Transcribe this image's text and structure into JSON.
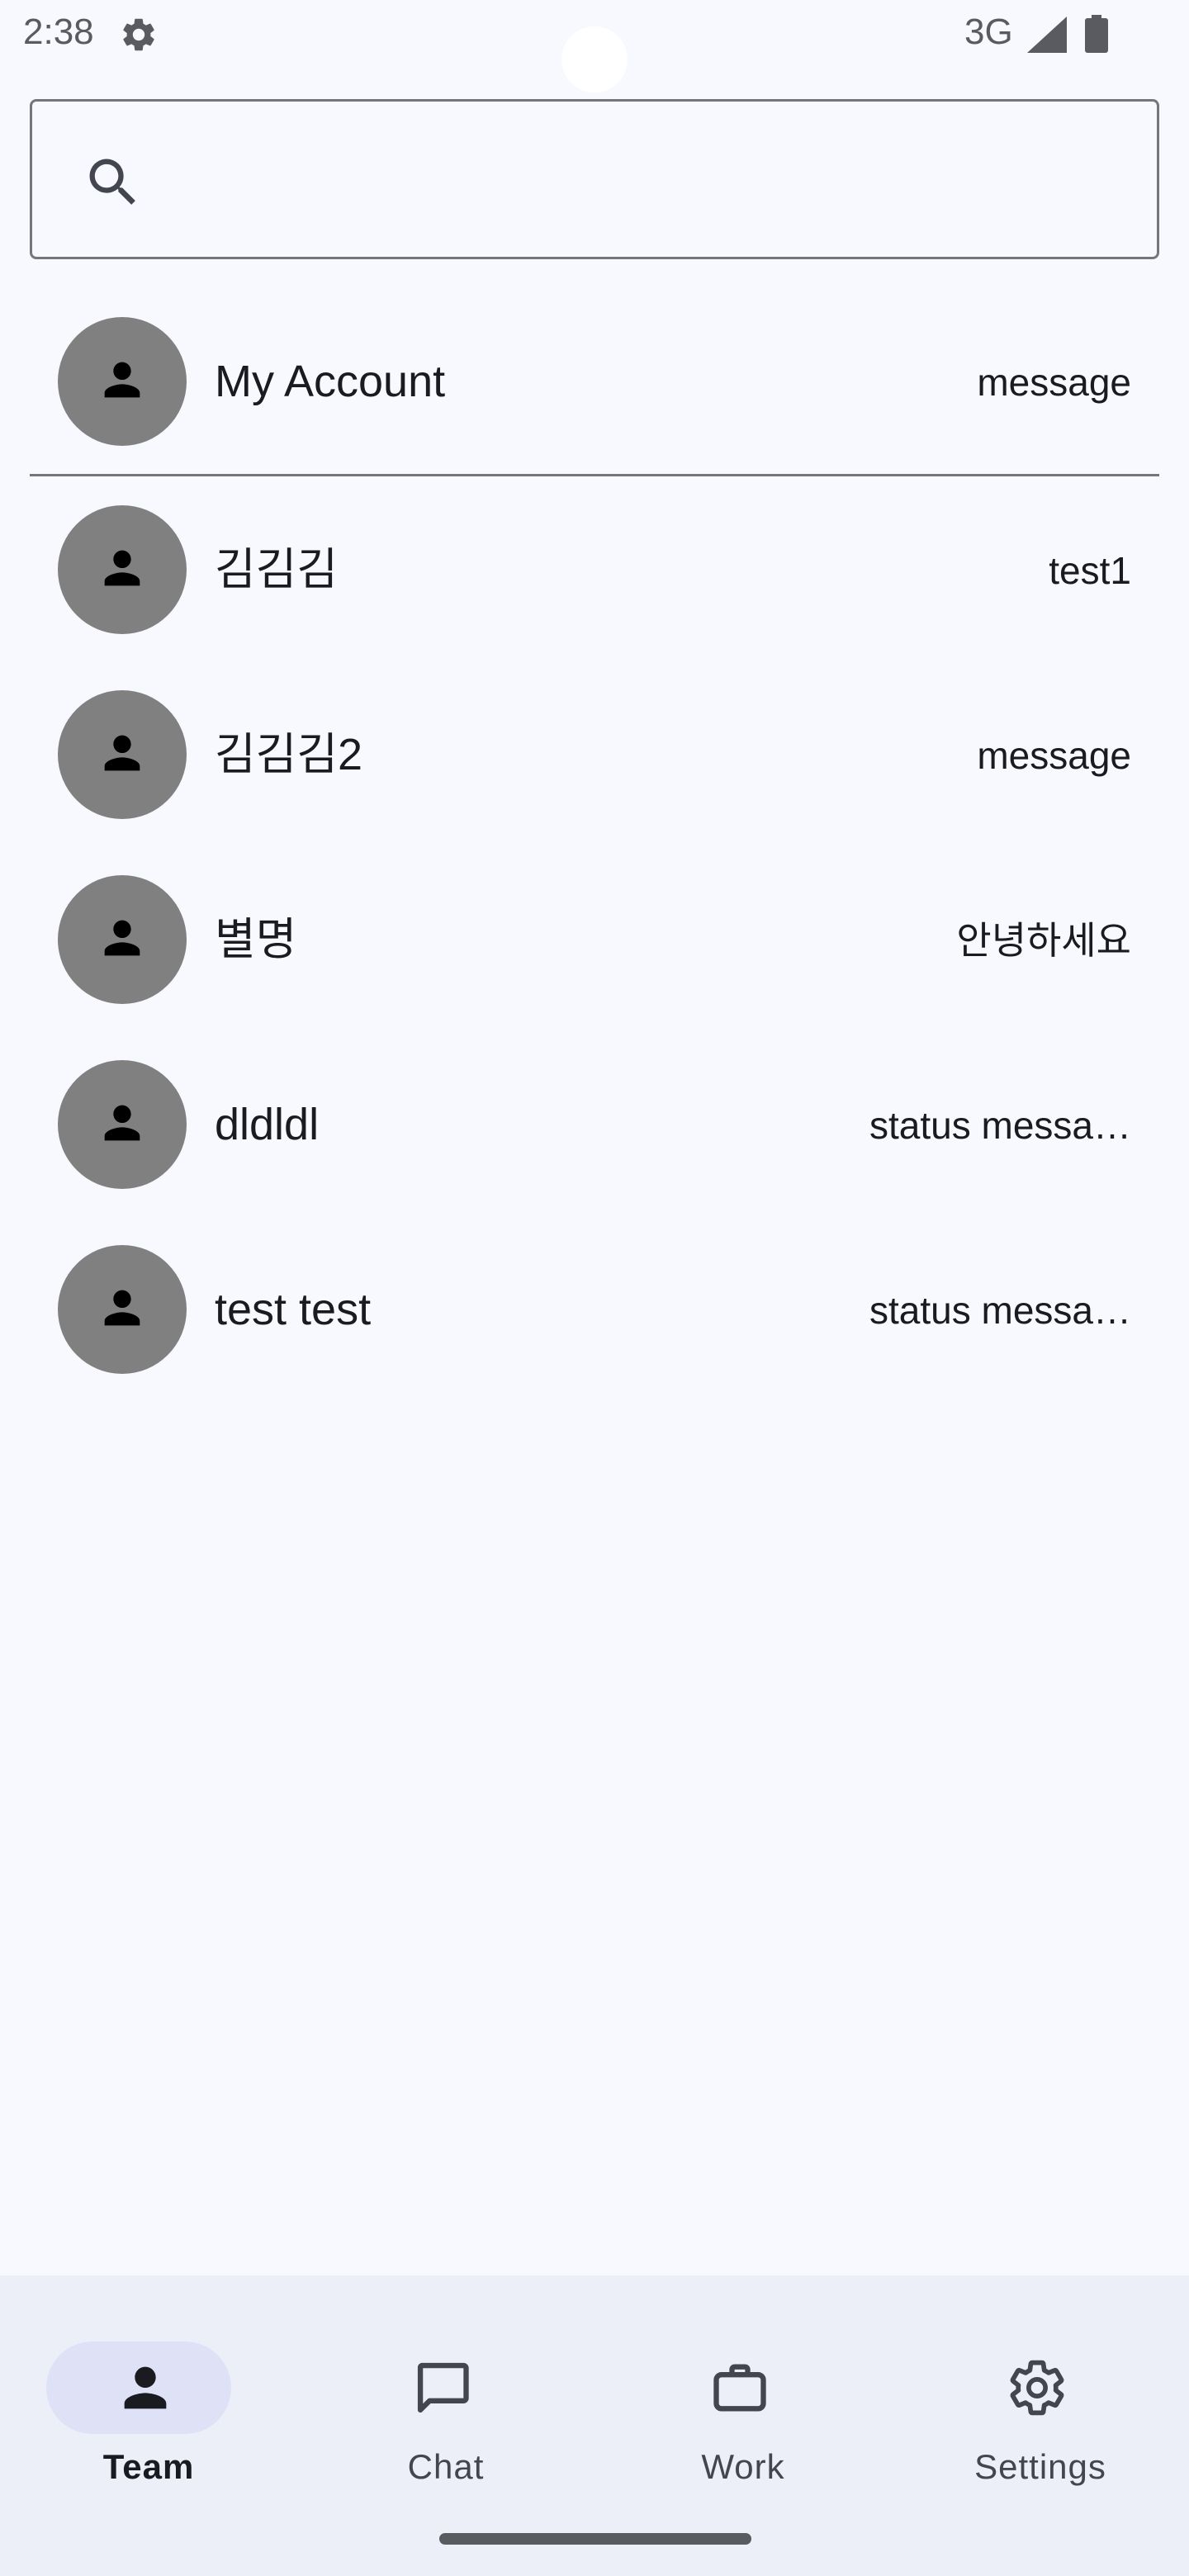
{
  "status_bar": {
    "time": "2:38",
    "network": "3G",
    "icons": [
      "gear-icon",
      "signal-icon",
      "battery-icon"
    ]
  },
  "search": {
    "placeholder": "",
    "icon": "search-icon"
  },
  "my_account": {
    "name": "My Account",
    "status": "message"
  },
  "contacts": [
    {
      "name": "김김김",
      "status": "test1"
    },
    {
      "name": "김김김2",
      "status": "message"
    },
    {
      "name": "별명",
      "status": "안녕하세요"
    },
    {
      "name": "dldldl",
      "status": "status messa…"
    },
    {
      "name": "test test",
      "status": "status messa…"
    }
  ],
  "bottom_nav": {
    "items": [
      {
        "label": "Team",
        "icon": "person-icon",
        "active": true
      },
      {
        "label": "Chat",
        "icon": "chat-icon",
        "active": false
      },
      {
        "label": "Work",
        "icon": "briefcase-icon",
        "active": false
      },
      {
        "label": "Settings",
        "icon": "gear-icon",
        "active": false
      }
    ]
  },
  "colors": {
    "background": "#f8f9ff",
    "avatar": "#808080",
    "nav_background": "#eceef8",
    "nav_active_pill": "#dfe2f7"
  }
}
